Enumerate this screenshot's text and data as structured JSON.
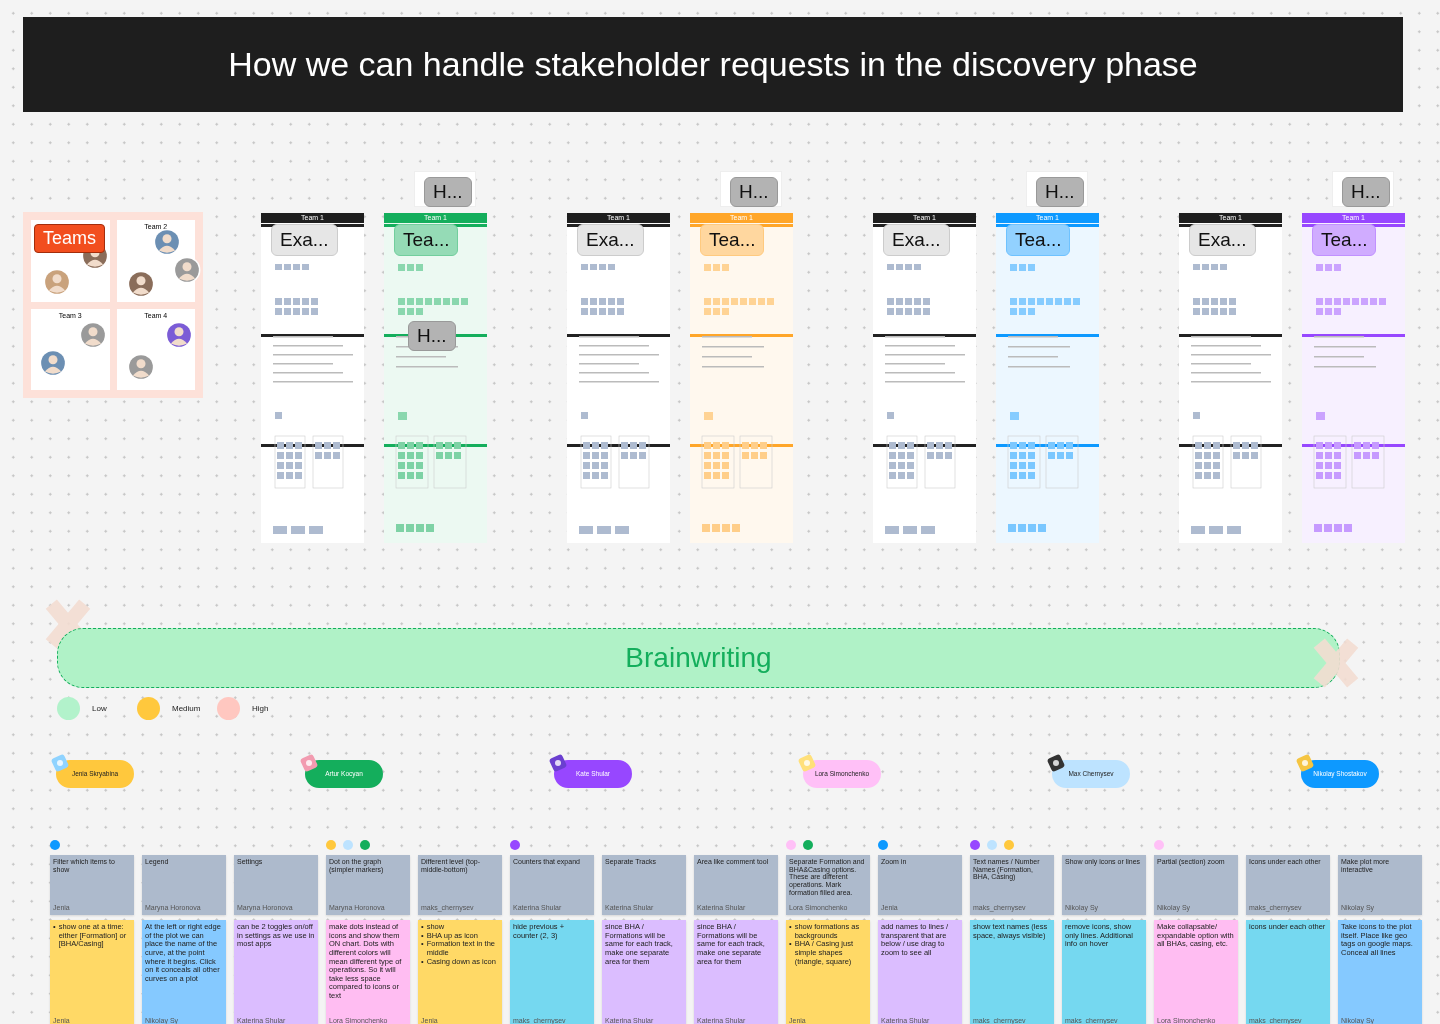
{
  "title": "How we can handle stakeholder requests in the discovery phase",
  "teams_card": {
    "label": "Teams",
    "teams": [
      {
        "members": [
          {
            "kind": "avatar"
          },
          {
            "kind": "avatar"
          }
        ]
      },
      {
        "name": "Team 2",
        "members": [
          {
            "kind": "avatar"
          },
          {
            "kind": "avatar"
          },
          {
            "kind": "avatar"
          }
        ]
      },
      {
        "name": "Team 3",
        "members": [
          {
            "kind": "avatar"
          },
          {
            "kind": "avatar"
          }
        ]
      },
      {
        "name": "Team 4",
        "members": [
          {
            "kind": "avatar"
          },
          {
            "kind": "avatar"
          }
        ]
      }
    ]
  },
  "boards": [
    {
      "example": {
        "label": "Exa...",
        "header": "Team 1"
      },
      "team": {
        "label": "Tea...",
        "header": "Team 1",
        "color": "#14ae5c",
        "tag": "H...",
        "inner_tag": "H..."
      }
    },
    {
      "example": {
        "label": "Exa...",
        "header": "Team 1"
      },
      "team": {
        "label": "Tea...",
        "header": "Team 1",
        "color": "#ffa629",
        "tag": "H..."
      }
    },
    {
      "example": {
        "label": "Exa...",
        "header": "Team 1"
      },
      "team": {
        "label": "Tea...",
        "header": "Team 1",
        "color": "#0d99ff",
        "tag": "H..."
      }
    },
    {
      "example": {
        "label": "Exa...",
        "header": "Team 1"
      },
      "team": {
        "label": "Tea...",
        "header": "Team 1",
        "color": "#9747ff",
        "tag": "H..."
      }
    }
  ],
  "banner": {
    "title": "Brainwriting"
  },
  "legend": [
    {
      "label": "Low",
      "color": "#b2f2cb"
    },
    {
      "label": "Medium",
      "color": "#ffc83d"
    },
    {
      "label": "High",
      "color": "#ffc7c0"
    }
  ],
  "participants": [
    {
      "name": "Jenia Skryabina",
      "color": "#ffc83d"
    },
    {
      "name": "Artur Kocyan",
      "color": "#14ae5c"
    },
    {
      "name": "Kate Shular",
      "color": "#9747ff"
    },
    {
      "name": "Lora Simonchenko",
      "color": "#ffc0f7"
    },
    {
      "name": "Max Chernysev",
      "color": "#bde3ff"
    },
    {
      "name": "Nikolay Shostakov",
      "color": "#0d99ff"
    }
  ],
  "columns": [
    {
      "dots": [
        {
          "color": "#0d99ff"
        }
      ],
      "idea": {
        "text": "Filter which items to show",
        "author": "Jenia"
      },
      "response": {
        "kind": "bullets",
        "marker": "•",
        "items": [
          "show one at a time: either [Formation] or [BHA/Casing]"
        ],
        "author": "Jenia",
        "color": "#ffd966"
      }
    },
    {
      "idea": {
        "text": "Legend",
        "author": "Maryna Horonova"
      },
      "response": {
        "kind": "text",
        "text": "At the left or right edge of the plot we can place the name of the curve, at the point where it begins. Click on it conceals all other curves on a plot",
        "author": "Nikolay Sy",
        "color": "#85c9ff"
      }
    },
    {
      "idea": {
        "text": "Settings",
        "author": "Maryna Horonova"
      },
      "response": {
        "kind": "text",
        "text": "can be 2 toggles on/off in settings as we use in most apps",
        "author": "Katerina Shular",
        "color": "#dbbdff"
      }
    },
    {
      "dots": [
        {
          "color": "#ffc83d"
        },
        {
          "color": "#bde3ff"
        },
        {
          "color": "#14ae5c"
        }
      ],
      "idea": {
        "text": "Dot on the graph (simpler markers)",
        "author": "Maryna Horonova"
      },
      "response": {
        "kind": "text",
        "text": "make dots instead of icons and show them ON chart. Dots with different colors will mean different type of operations. So it will take less space compared to icons or text",
        "author": "Lora Simonchenko",
        "color": "#ffbdf2"
      }
    },
    {
      "idea": {
        "text": "Different level (top-middle-bottom)",
        "author": "maks_chernysev"
      },
      "response": {
        "kind": "bullets",
        "marker": "•",
        "items": [
          "show",
          "BHA up as icon",
          "Formation text in the middle",
          "Casing down as icon"
        ],
        "author": "Jenia",
        "color": "#ffd966"
      }
    },
    {
      "dots": [
        {
          "color": "#9747ff"
        }
      ],
      "idea": {
        "text": "Counters that expand",
        "author": "Katerina Shular"
      },
      "response": {
        "kind": "text",
        "text": "hide previous + counter (2, 3)",
        "author": "maks_chernysev",
        "color": "#75d8f0"
      }
    },
    {
      "idea": {
        "text": "Separate Tracks",
        "author": "Katerina Shular"
      },
      "response": {
        "kind": "text",
        "text": "since BHA / Formations will be same for each track, make one separate area for them",
        "author": "Katerina Shular",
        "color": "#dbbdff"
      }
    },
    {
      "idea": {
        "text": "Area like comment tool",
        "author": "Katerina Shular"
      },
      "response": {
        "kind": "text",
        "text": "since BHA / Formations will be same for each track, make one separate area for them",
        "author": "Katerina Shular",
        "color": "#dbbdff"
      }
    },
    {
      "dots": [
        {
          "color": "#ffc0f7"
        },
        {
          "color": "#14ae5c"
        }
      ],
      "idea": {
        "text": "Separate Formation and BHA&Casing options. These are different operations. Mark formation filled area.",
        "author": "Lora Simonchenko"
      },
      "response": {
        "kind": "bullets",
        "marker": "•",
        "items": [
          "show formations as backgrounds",
          "BHA / Casing just simple shapes (triangle, square)"
        ],
        "author": "Jenia",
        "color": "#ffd966"
      }
    },
    {
      "dots": [
        {
          "color": "#0d99ff"
        }
      ],
      "idea": {
        "text": "Zoom in",
        "author": "Jenia"
      },
      "response": {
        "kind": "text",
        "text": "add names to lines / transparent that are below / use drag to zoom to see all",
        "author": "Katerina Shular",
        "color": "#dbbdff"
      }
    },
    {
      "dots": [
        {
          "color": "#9747ff"
        },
        {
          "color": "#bde3ff"
        },
        {
          "color": "#ffc83d"
        }
      ],
      "idea": {
        "text": "Text names / Number Names (Formation, BHA, Casing)",
        "author": "maks_chernysev"
      },
      "response": {
        "kind": "text",
        "text": "show text names (less space, always visible)",
        "author": "maks_chernysev",
        "color": "#75d8f0"
      }
    },
    {
      "idea": {
        "text": "Show only icons or lines",
        "author": "Nikolay Sy"
      },
      "response": {
        "kind": "text",
        "text": "remove icons, show only lines. Additional info on hover",
        "author": "maks_chernysev",
        "color": "#75d8f0"
      }
    },
    {
      "dots": [
        {
          "color": "#ffc0f7"
        }
      ],
      "idea": {
        "text": "Partial (section) zoom",
        "author": "Nikolay Sy"
      },
      "response": {
        "kind": "text",
        "text": "Make collapsable/ expandable option with all BHAs, casing, etc.",
        "author": "Lora Simonchenko",
        "color": "#ffbdf2"
      }
    },
    {
      "idea": {
        "text": "Icons under each other",
        "author": "maks_chernysev"
      },
      "response": {
        "kind": "text",
        "text": "icons under each other",
        "author": "maks_chernysev",
        "color": "#75d8f0"
      }
    },
    {
      "idea": {
        "text": "Make plot more interactive",
        "author": "Nikolay Sy"
      },
      "response": {
        "kind": "text",
        "text": "Take icons to the plot itself. Place like geo tags on google maps. Conceal all lines",
        "author": "Nikolay Sy",
        "color": "#85c9ff"
      }
    }
  ]
}
